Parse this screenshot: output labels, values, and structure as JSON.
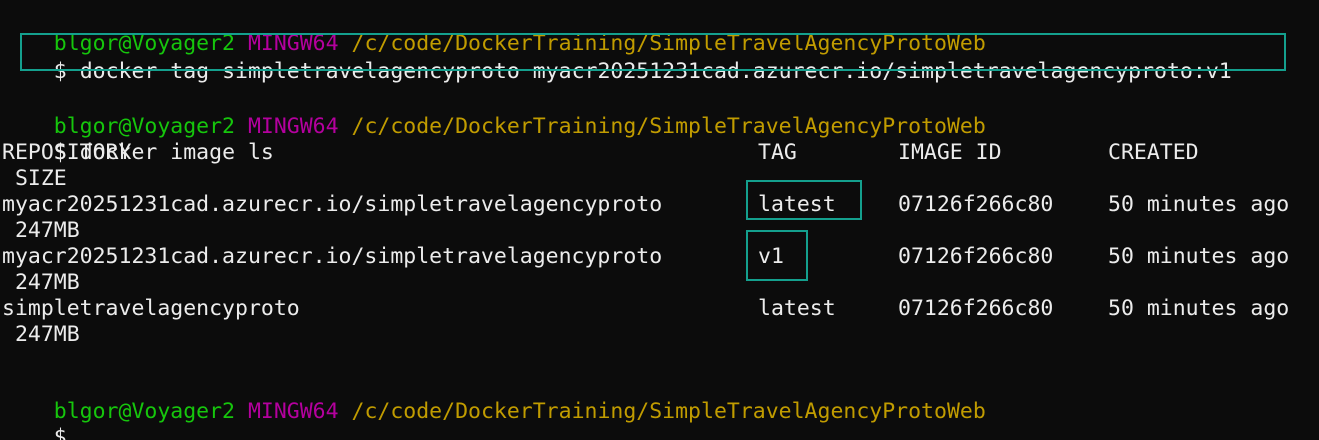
{
  "window": {
    "title": "MINGW64 terminal"
  },
  "prompt": {
    "user_host": "blgor@Voyager2",
    "shell": "MINGW64",
    "path": "/c/code/DockerTraining/SimpleTravelAgencyProtoWeb",
    "symbol": "$"
  },
  "commands": {
    "tag": "docker tag simpletravelagencyproto myacr20251231cad.azurecr.io/simpletravelagencyproto:v1",
    "image_ls": "docker image ls"
  },
  "table": {
    "headers": {
      "repository": "REPOSITORY",
      "tag": "TAG",
      "image_id": "IMAGE ID",
      "created": "CREATED",
      "size": "SIZE"
    },
    "rows": [
      {
        "repository": "myacr20251231cad.azurecr.io/simpletravelagencyproto",
        "tag": "latest",
        "image_id": "07126f266c80",
        "created": "50 minutes ago",
        "size": "247MB"
      },
      {
        "repository": "myacr20251231cad.azurecr.io/simpletravelagencyproto",
        "tag": "v1",
        "image_id": "07126f266c80",
        "created": "50 minutes ago",
        "size": "247MB"
      },
      {
        "repository": "simpletravelagencyproto",
        "tag": "latest",
        "image_id": "07126f266c80",
        "created": "50 minutes ago",
        "size": "247MB"
      }
    ]
  },
  "colors": {
    "background": "#0c0c0c",
    "text": "#ececec",
    "user_host": "#16c60c",
    "shell": "#b4009e",
    "path": "#c19c00",
    "highlight_box": "#14a08e"
  }
}
